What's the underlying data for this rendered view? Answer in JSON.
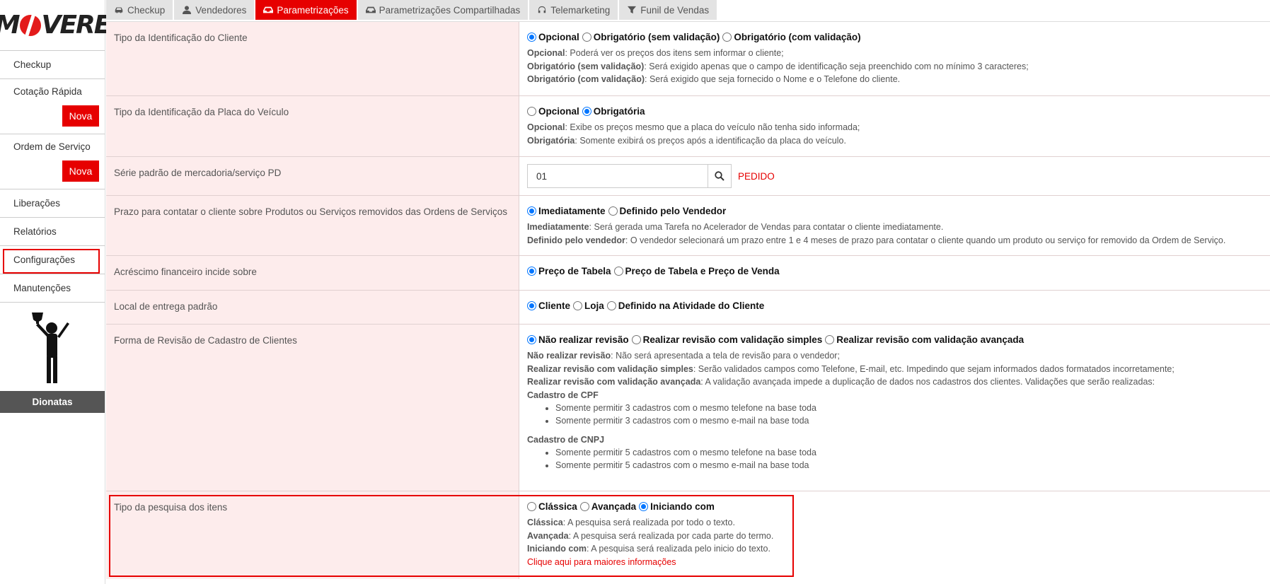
{
  "logo": {
    "text": "MOVERE"
  },
  "sidebar": {
    "items": [
      {
        "label": "Checkup"
      },
      {
        "label": "Cotação Rápida",
        "button": "Nova"
      },
      {
        "label": "Ordem de Serviço",
        "button": "Nova"
      },
      {
        "label": "Liberações"
      },
      {
        "label": "Relatórios"
      },
      {
        "label": "Configurações",
        "highlighted": true
      },
      {
        "label": "Manutenções"
      }
    ],
    "user": "Dionatas"
  },
  "tabs": [
    {
      "label": "Checkup",
      "icon": "car-icon"
    },
    {
      "label": "Vendedores",
      "icon": "user-icon"
    },
    {
      "label": "Parametrizações",
      "icon": "inbox-icon",
      "active": true
    },
    {
      "label": "Parametrizações Compartilhadas",
      "icon": "inbox-icon"
    },
    {
      "label": "Telemarketing",
      "icon": "headset-icon"
    },
    {
      "label": "Funil de Vendas",
      "icon": "filter-icon"
    }
  ],
  "colors": {
    "accent": "#e60000",
    "label_bg": "#fdecec",
    "radio_selected": "#0075ff"
  },
  "settings": {
    "client_id": {
      "label": "Tipo da Identificação do Cliente",
      "options": [
        "Opcional",
        "Obrigatório (sem validação)",
        "Obrigatório (com validação)"
      ],
      "selected": 0,
      "desc": [
        {
          "b": "Opcional",
          "t": ": Poderá ver os preços dos itens sem informar o cliente;"
        },
        {
          "b": "Obrigatório (sem validação)",
          "t": ": Será exigido apenas que o campo de identificação seja preenchido com no mínimo 3 caracteres;"
        },
        {
          "b": "Obrigatório (com validação)",
          "t": ": Será exigido que seja fornecido o Nome e o Telefone do cliente."
        }
      ]
    },
    "plate_id": {
      "label": "Tipo da Identificação da Placa do Veículo",
      "options": [
        "Opcional",
        "Obrigatória"
      ],
      "selected": 1,
      "desc": [
        {
          "b": "Opcional",
          "t": ": Exibe os preços mesmo que a placa do veículo não tenha sido informada;"
        },
        {
          "b": "Obrigatória",
          "t": ": Somente exibirá os preços após a identificação da placa do veículo."
        }
      ]
    },
    "series": {
      "label": "Série padrão de mercadoria/serviço PD",
      "value": "01",
      "value_desc": "PEDIDO"
    },
    "contact_deadline": {
      "label": "Prazo para contatar o cliente sobre Produtos ou Serviços removidos das Ordens de Serviços",
      "options": [
        "Imediatamente",
        "Definido pelo Vendedor"
      ],
      "selected": 0,
      "desc": [
        {
          "b": "Imediatamente",
          "t": ": Será gerada uma Tarefa no Acelerador de Vendas para contatar o cliente imediatamente."
        },
        {
          "b": "Definido pelo vendedor",
          "t": ": O vendedor selecionará um prazo entre 1 e 4 meses de prazo para contatar o cliente quando um produto ou serviço for removido da Ordem de Serviço."
        }
      ]
    },
    "financial": {
      "label": "Acréscimo financeiro incide sobre",
      "options": [
        "Preço de Tabela",
        "Preço de Tabela e Preço de Venda"
      ],
      "selected": 0
    },
    "delivery": {
      "label": "Local de entrega padrão",
      "options": [
        "Cliente",
        "Loja",
        "Definido na Atividade do Cliente"
      ],
      "selected": 0
    },
    "review": {
      "label": "Forma de Revisão de Cadastro de Clientes",
      "options": [
        "Não realizar revisão",
        "Realizar revisão com validação simples",
        "Realizar revisão com validação avançada"
      ],
      "selected": 0,
      "desc": [
        {
          "b": "Não realizar revisão",
          "t": ": Não será apresentada a tela de revisão para o vendedor;"
        },
        {
          "b": "Realizar revisão com validação simples",
          "t": ": Serão validados campos como Telefone, E-mail, etc. Impedindo que sejam informados dados formatados incorretamente;"
        },
        {
          "b": "Realizar revisão com validação avançada",
          "t": ": A validação avançada impede a duplicação de dados nos cadastros dos clientes. Validações que serão realizadas:"
        }
      ],
      "cpf_title": "Cadastro de CPF",
      "cpf_items": [
        "Somente permitir 3 cadastros com o mesmo telefone na base toda",
        "Somente permitir 3 cadastros com o mesmo e-mail na base toda"
      ],
      "cnpj_title": "Cadastro de CNPJ",
      "cnpj_items": [
        "Somente permitir 5 cadastros com o mesmo telefone na base toda",
        "Somente permitir 5 cadastros com o mesmo e-mail na base toda"
      ]
    },
    "search_type": {
      "label": "Tipo da pesquisa dos itens",
      "options": [
        "Clássica",
        "Avançada",
        "Iniciando com"
      ],
      "selected": 2,
      "desc": [
        {
          "b": "Clássica",
          "t": ": A pesquisa será realizada por todo o texto."
        },
        {
          "b": "Avançada",
          "t": ": A pesquisa será realizada por cada parte do termo."
        },
        {
          "b": "Iniciando com",
          "t": ": A pesquisa será realizada pelo inicio do texto."
        }
      ],
      "link": "Clique aqui para maiores informações"
    }
  }
}
